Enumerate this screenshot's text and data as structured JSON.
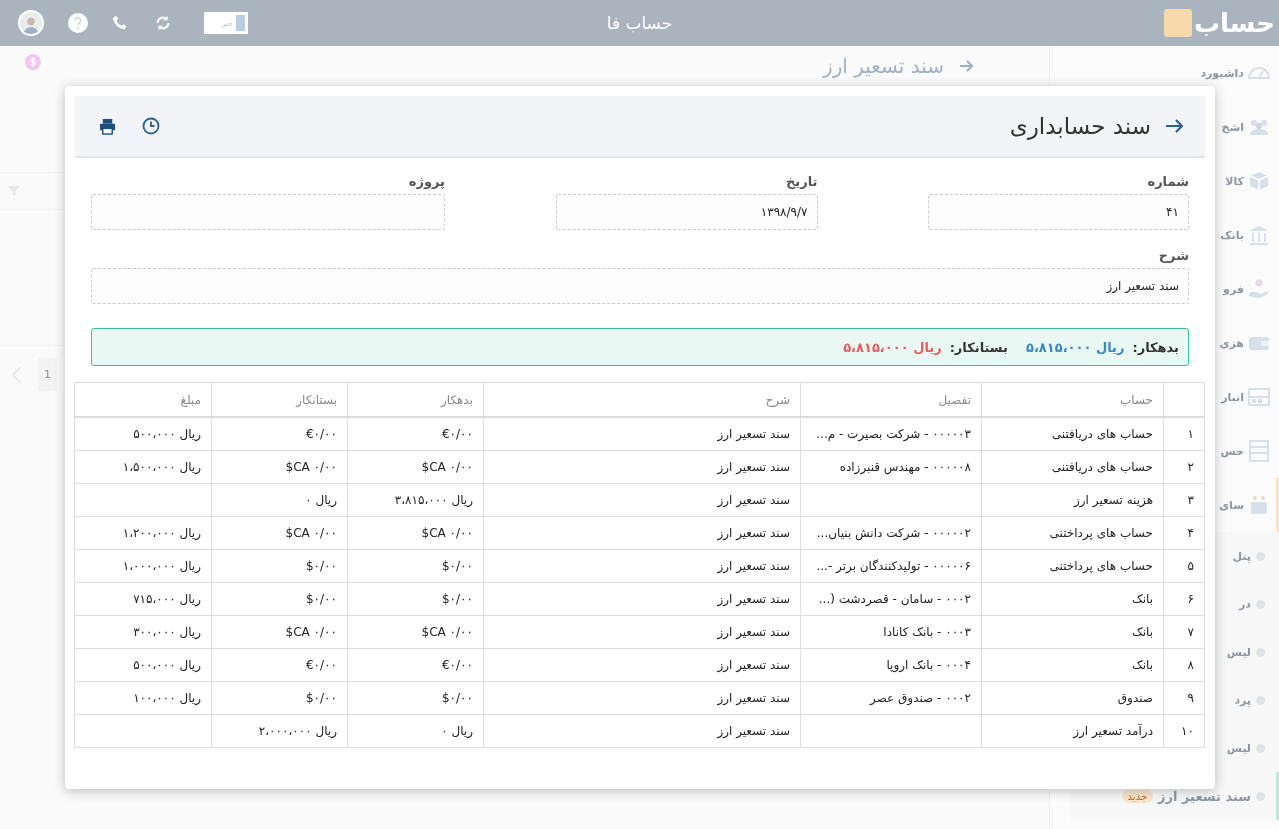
{
  "topbar": {
    "title": "حساب فا",
    "logo_text": "حساب",
    "news_label": "خبر"
  },
  "sidebar": {
    "items": [
      {
        "label": "داشبورد",
        "kind": "main",
        "selected": false,
        "expanded": false
      },
      {
        "label": "اشخ",
        "kind": "main",
        "selected": false,
        "expanded": false
      },
      {
        "label": "کالا",
        "kind": "main",
        "selected": false,
        "expanded": false
      },
      {
        "label": "بانک",
        "kind": "main",
        "selected": false,
        "expanded": false
      },
      {
        "label": "فرو",
        "kind": "main",
        "selected": false,
        "expanded": false
      },
      {
        "label": "هزی",
        "kind": "main",
        "selected": false,
        "expanded": false
      },
      {
        "label": "انبار",
        "kind": "main",
        "selected": false,
        "expanded": false
      },
      {
        "label": "حس",
        "kind": "main",
        "selected": false,
        "expanded": false
      },
      {
        "label": "سای",
        "kind": "main",
        "selected": false,
        "expanded": true
      },
      {
        "label": "پنل",
        "kind": "sub",
        "selected": false
      },
      {
        "label": "در",
        "kind": "sub",
        "selected": false
      },
      {
        "label": "لیس",
        "kind": "sub",
        "selected": false
      },
      {
        "label": "پرد",
        "kind": "sub",
        "selected": false
      },
      {
        "label": "لیس",
        "kind": "sub",
        "selected": false
      },
      {
        "label": "سند تسعیر ارز",
        "kind": "sub",
        "selected": true,
        "badge": "جدید"
      }
    ]
  },
  "page": {
    "title": "سند تسعیر ارز",
    "pager": "1"
  },
  "modal": {
    "title": "سند حسابداری",
    "fields": [
      {
        "label": "شماره",
        "value": "۴۱"
      },
      {
        "label": "تاریخ",
        "value": "۱۳۹۸/۹/۷"
      },
      {
        "label": "پروژه"
      }
    ],
    "description": {
      "label": "شرح",
      "value": "سند تسعیر ارز"
    },
    "summary": {
      "debit_label": "بدهکار:",
      "debit": "ریال ۵،۸۱۵،۰۰۰",
      "credit_label": "بستانکار:",
      "credit": "ریال ۵،۸۱۵،۰۰۰"
    },
    "table": {
      "columns": [
        "",
        "حساب",
        "تفصیل",
        "شرح",
        "بدهکار",
        "بستانکار",
        "مبلغ"
      ],
      "rows": [
        [
          "۱",
          "حساب های دریافتنی",
          "۰۰۰۰۰۳ - شرکت بصیرت - م...",
          "سند تسعیر ارز",
          "€۰/۰۰",
          "€۰/۰۰",
          "ریال ۵۰۰،۰۰۰"
        ],
        [
          "۲",
          "حساب های دریافتنی",
          "۰۰۰۰۰۸ - مهندس قنبرزاده",
          "سند تسعیر ارز",
          "$CA ۰/۰۰",
          "$CA ۰/۰۰",
          "ریال ۱،۵۰۰،۰۰۰"
        ],
        [
          "۳",
          "هزینه تسعیر ارز",
          "",
          "سند تسعیر ارز",
          "ریال ۳،۸۱۵،۰۰۰",
          "ریال ۰",
          ""
        ],
        [
          "۴",
          "حساب های پرداختنی",
          "۰۰۰۰۰۲ - شرکت دانش بنیان...",
          "سند تسعیر ارز",
          "$CA ۰/۰۰",
          "$CA ۰/۰۰",
          "ریال ۱،۲۰۰،۰۰۰"
        ],
        [
          "۵",
          "حساب های پرداختنی",
          "۰۰۰۰۰۶ - تولیدکنندگان برتر -...",
          "سند تسعیر ارز",
          "$۰/۰۰",
          "$۰/۰۰",
          "ریال ۱،۰۰۰،۰۰۰"
        ],
        [
          "۶",
          "بانک",
          "۰۰۰۲ - سامان - قصردشت (...",
          "سند تسعیر ارز",
          "$۰/۰۰",
          "$۰/۰۰",
          "ریال ۷۱۵،۰۰۰"
        ],
        [
          "۷",
          "بانک",
          "۰۰۰۳ - بانک کانادا",
          "سند تسعیر ارز",
          "$CA ۰/۰۰",
          "$CA ۰/۰۰",
          "ریال ۳۰۰،۰۰۰"
        ],
        [
          "۸",
          "بانک",
          "۰۰۰۴ - بانک اروپا",
          "سند تسعیر ارز",
          "€۰/۰۰",
          "€۰/۰۰",
          "ریال ۵۰۰،۰۰۰"
        ],
        [
          "۹",
          "صندوق",
          "۰۰۰۲ - صندوق عصر",
          "سند تسعیر ارز",
          "$۰/۰۰",
          "$۰/۰۰",
          "ریال ۱۰۰،۰۰۰"
        ],
        [
          "۱۰",
          "درآمد تسعیر ارز",
          "",
          "سند تسعیر ارز",
          "ریال ۰",
          "ریال ۲،۰۰۰،۰۰۰",
          ""
        ]
      ]
    }
  }
}
